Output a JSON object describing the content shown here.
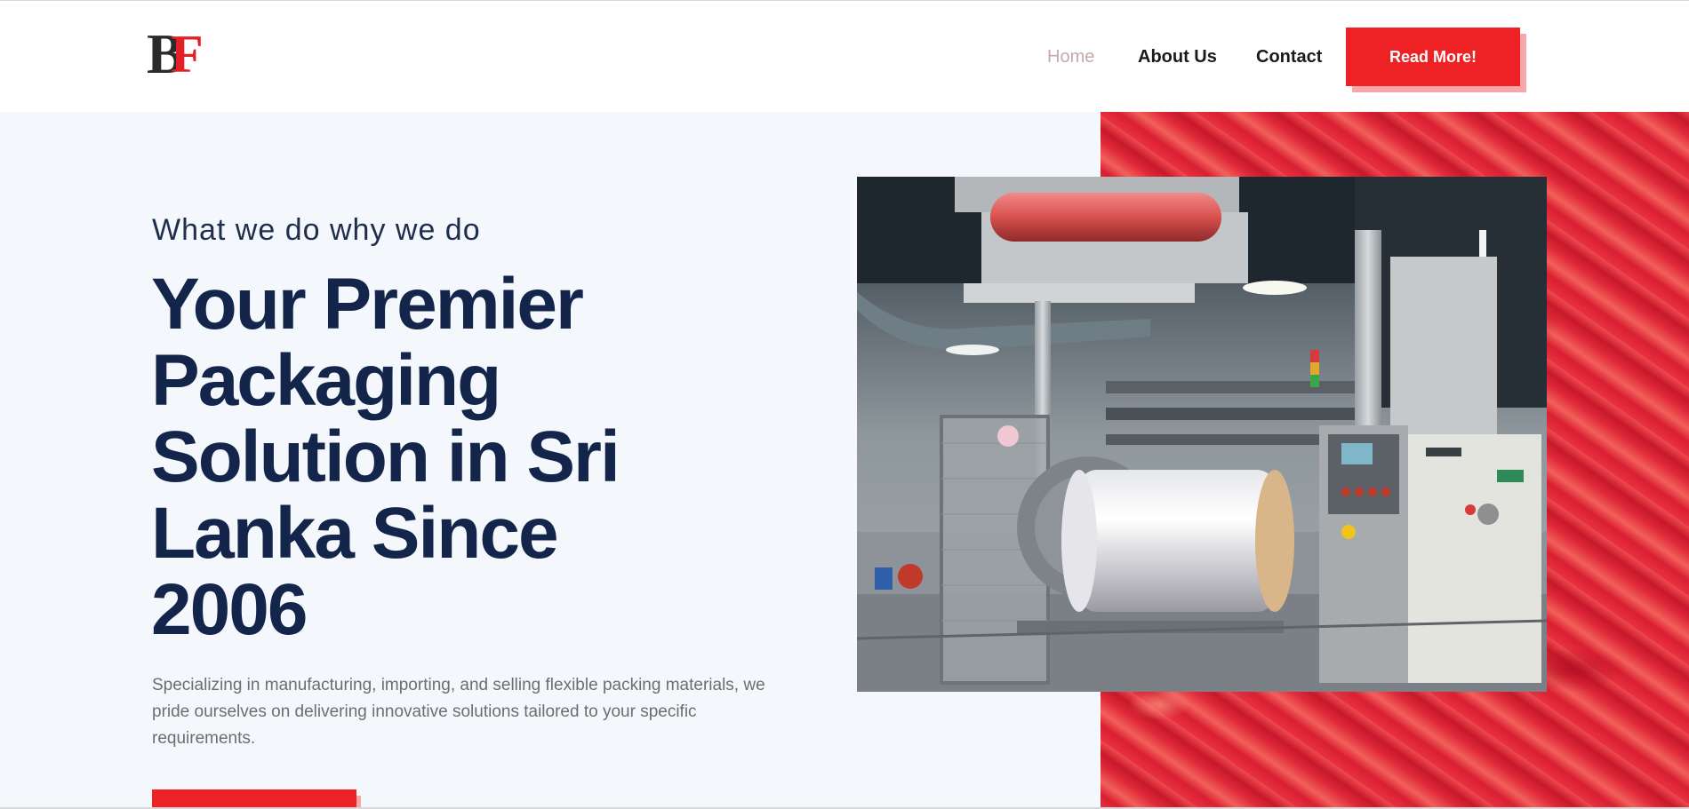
{
  "brand": {
    "logo_b": "B",
    "logo_f": "F"
  },
  "nav": {
    "home": "Home",
    "about": "About Us",
    "contact": "Contact",
    "cta": "Read More!"
  },
  "hero": {
    "subtitle": "What we do why we do",
    "headline": "Your Premier Packaging Solution in Sri Lanka Since 2006",
    "description": "Specializing in manufacturing, importing, and selling flexible packing materials, we pride ourselves on delivering innovative solutions tailored to your specific requirements."
  },
  "colors": {
    "accent": "#ee2124",
    "heading": "#13254a",
    "hero_bg": "#f4f8fc"
  },
  "icons": [
    "logo-mark",
    "machine-photo"
  ]
}
